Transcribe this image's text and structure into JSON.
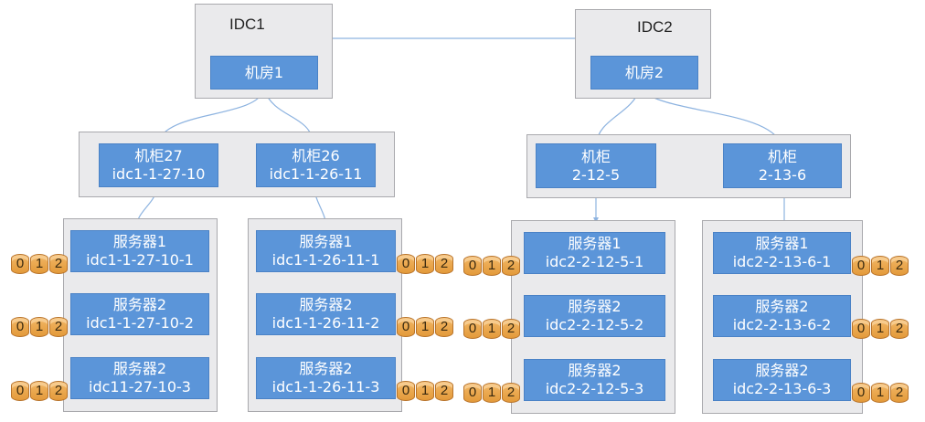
{
  "colors": {
    "node": "#5b95d9",
    "box": "#eaeaec",
    "link": "#8db3e0",
    "disk": "#e8a14a"
  },
  "idc1": {
    "label": "IDC1",
    "room": "机房1",
    "racks": [
      {
        "name": "机柜27",
        "id": "idc1-1-27-10"
      },
      {
        "name": "机柜26",
        "id": "idc1-1-26-11"
      }
    ],
    "groups": [
      {
        "servers": [
          {
            "name": "服务器1",
            "id": "idc1-1-27-10-1"
          },
          {
            "name": "服务器2",
            "id": "idc1-1-27-10-2"
          },
          {
            "name": "服务器2",
            "id": "idc11-27-10-3"
          }
        ]
      },
      {
        "servers": [
          {
            "name": "服务器1",
            "id": "idc1-1-26-11-1"
          },
          {
            "name": "服务器2",
            "id": "idc1-1-26-11-2"
          },
          {
            "name": "服务器2",
            "id": "idc1-1-26-11-3"
          }
        ]
      }
    ]
  },
  "idc2": {
    "label": "IDC2",
    "room": "机房2",
    "racks": [
      {
        "name": "机柜",
        "id": "2-12-5"
      },
      {
        "name": "机柜",
        "id": "2-13-6"
      }
    ],
    "groups": [
      {
        "servers": [
          {
            "name": "服务器1",
            "id": "idc2-2-12-5-1"
          },
          {
            "name": "服务器2",
            "id": "idc2-2-12-5-2"
          },
          {
            "name": "服务器2",
            "id": "idc2-2-12-5-3"
          }
        ]
      },
      {
        "servers": [
          {
            "name": "服务器1",
            "id": "idc2-2-13-6-1"
          },
          {
            "name": "服务器2",
            "id": "idc2-2-13-6-2"
          },
          {
            "name": "服务器2",
            "id": "idc2-2-13-6-3"
          }
        ]
      }
    ]
  },
  "disk_labels": [
    "0",
    "1",
    "2"
  ]
}
